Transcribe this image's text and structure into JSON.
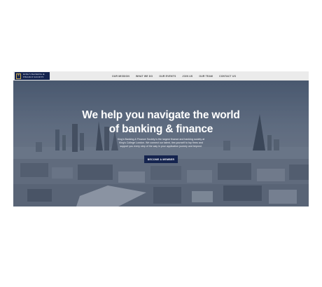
{
  "header": {
    "logo_text_line1": "KING'S BANKING &",
    "logo_text_line2": "FINANCE SOCIETY",
    "nav": [
      {
        "label": "OUR MISSION"
      },
      {
        "label": "WHAT WE DO"
      },
      {
        "label": "OUR EVENTS"
      },
      {
        "label": "JOIN US"
      },
      {
        "label": "OUR TEAM"
      },
      {
        "label": "CONTACT US"
      }
    ]
  },
  "hero": {
    "headline_line1": "We help you navigate the world",
    "headline_line2": "of banking & finance",
    "subtext": "King's Banking & Finance Society is the largest finance and banking society at King's College London. We connect our talent, ties yourself to top firms and support you every step of the way in your application journey and beyond.",
    "cta_label": "BECOME A MEMBER"
  },
  "colors": {
    "brand_navy": "#15244f",
    "nav_bg": "#ebebeb",
    "gold": "#c9a84c"
  },
  "icons": {
    "logo": "crest-icon"
  }
}
